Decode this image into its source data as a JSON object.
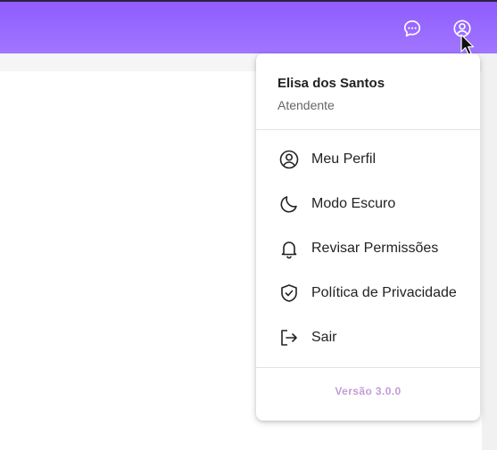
{
  "header": {
    "chat_icon": "chat-bubble-icon",
    "account_icon": "account-circle-icon",
    "gradient_start": "#8f5cff",
    "gradient_end": "#a176ff"
  },
  "user_menu": {
    "name": "Elisa dos Santos",
    "role": "Atendente",
    "items": [
      {
        "label": "Meu Perfil",
        "icon": "account-circle-icon"
      },
      {
        "label": "Modo Escuro",
        "icon": "moon-icon"
      },
      {
        "label": "Revisar Permissões",
        "icon": "bell-icon"
      },
      {
        "label": "Política de Privacidade",
        "icon": "shield-check-icon"
      },
      {
        "label": "Sair",
        "icon": "logout-icon"
      }
    ],
    "version": "Versão 3.0.0"
  },
  "colors": {
    "version_text": "#c59bd8"
  }
}
